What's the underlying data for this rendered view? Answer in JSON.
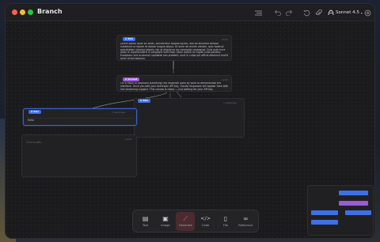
{
  "window": {
    "title": "Branch"
  },
  "toolbar_top": {
    "icons": [
      "list-icon",
      "undo-icon",
      "redo-icon",
      "history-icon",
      "attach-icon"
    ],
    "model_label": "Sonnet 4.5"
  },
  "nodes": [
    {
      "id": "root",
      "badge": "A Site",
      "badge_color": "#3e6fe6",
      "meta": "12:01",
      "text": "Lorem ipsum dolor sit amet, consectetur adipiscing elit, sed do eiusmod tempor incididunt ut labore et dolore magna aliqua. Ut enim ad minim veniam, quis nostrud exercitation ullamco laboris nisi ut aliquip ex ea commodo consequat. Duis aute irure dolor in reprehenderit in voluptate velit esse cillum dolore eu fugiat nulla pariatur. Excepteur sint occaecat cupidatat non proident, sunt in culpa qui officia deserunt mollit anim id est laborum."
    },
    {
      "id": "response",
      "badge": "A Sonnet",
      "badge_color": "#9a5bd6",
      "meta": "12:02",
      "text": "I'm a mock AI assistant streaming this response word by word to demonstrate the interface. Once you add your Anthropic API key, Claude responses will appear here with live streaming support. This canvas is ready — just waiting for your API key."
    },
    {
      "id": "branch-right",
      "badge": "A Site",
      "badge_color": "#3e6fe6",
      "meta": "1 responses"
    },
    {
      "id": "branch-left",
      "badge": "A Site",
      "badge_color": "#3e6fe6",
      "meta": "1 responses",
      "text": "Hello"
    },
    {
      "id": "empty",
      "meta": "12:03",
      "text": "Click to edit..."
    }
  ],
  "bottom_toolbar": {
    "tools": [
      {
        "label": "Text",
        "icon": "text-icon",
        "glyph": "▤"
      },
      {
        "label": "Image",
        "icon": "image-icon",
        "glyph": "▣"
      },
      {
        "label": "Generate",
        "icon": "generate-icon",
        "glyph": "⟋"
      },
      {
        "label": "Code",
        "icon": "code-icon",
        "glyph": "</>"
      },
      {
        "label": "File",
        "icon": "file-icon",
        "glyph": "▯"
      },
      {
        "label": "Reference",
        "icon": "link-icon",
        "glyph": "∞"
      }
    ]
  },
  "minimap": {
    "colors": {
      "blue": "#3e6fe6",
      "purple": "#9a5bd6"
    }
  }
}
